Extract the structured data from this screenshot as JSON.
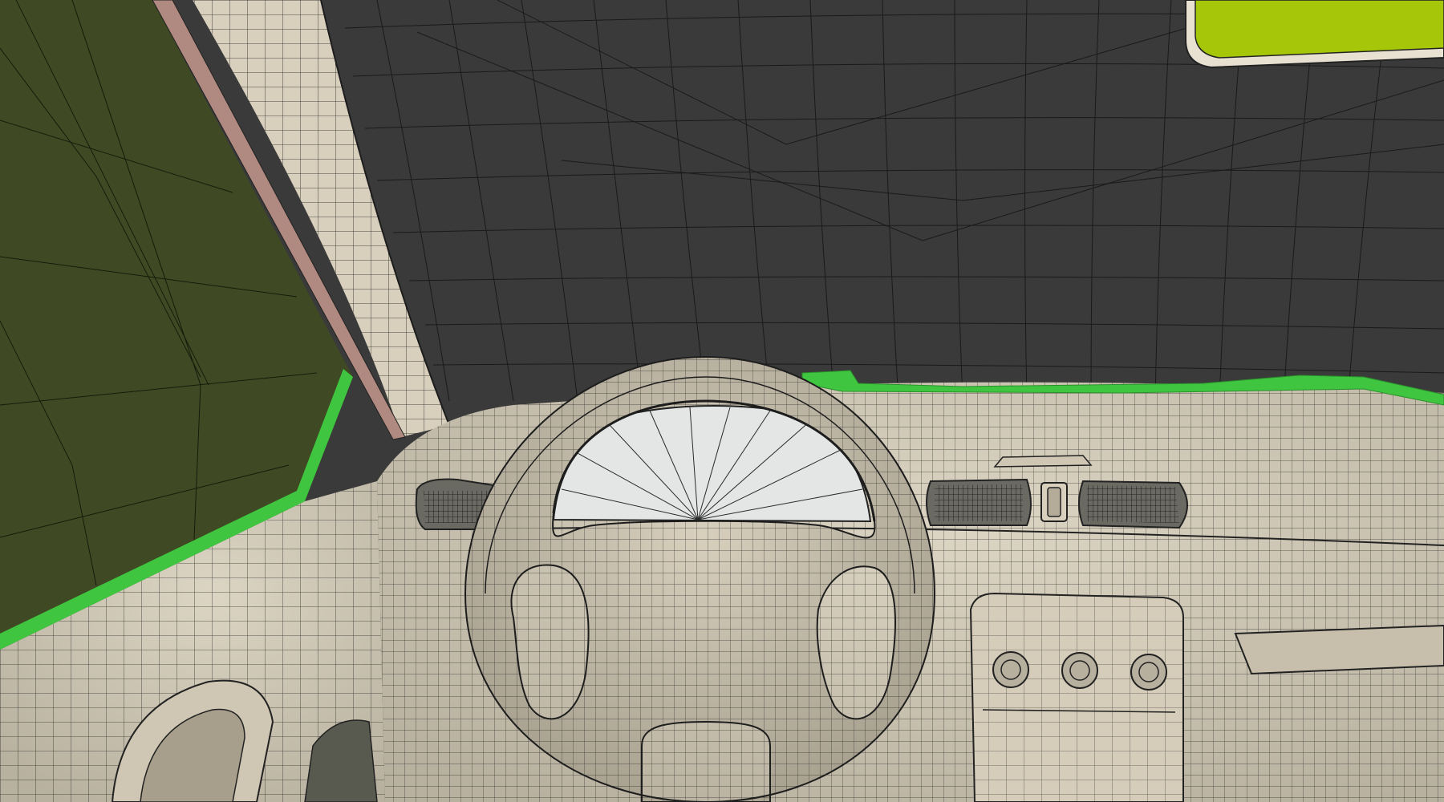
{
  "viewport": {
    "mode": "wireframe-shaded",
    "colors": {
      "background": "#3b3b3b",
      "headliner": "#3a3a3a",
      "door_glass": "#3f4a24",
      "highlight_green": "#3fc53f",
      "pillar_trim": "#b08a80",
      "surface": "#d4cbb8",
      "surface_shadow": "#a69f8f",
      "cluster_glass": "#e4e6e6",
      "mirror": "#a6c60a",
      "wire": "#1d1d1d"
    }
  },
  "objects": [
    {
      "name": "door-window-glass",
      "selected": false
    },
    {
      "name": "a-pillar-trim",
      "selected": false
    },
    {
      "name": "roof-headliner",
      "selected": false
    },
    {
      "name": "rear-view-mirror",
      "selected": false
    },
    {
      "name": "dashboard",
      "selected": false
    },
    {
      "name": "windshield-edge-strip",
      "selected": true
    },
    {
      "name": "instrument-cluster-glass",
      "selected": false
    },
    {
      "name": "steering-wheel",
      "selected": false
    },
    {
      "name": "center-air-vents",
      "selected": false
    },
    {
      "name": "side-air-vent",
      "selected": false
    },
    {
      "name": "center-console",
      "selected": false
    },
    {
      "name": "climate-knobs",
      "count": 3
    },
    {
      "name": "door-panel",
      "selected": false
    }
  ]
}
